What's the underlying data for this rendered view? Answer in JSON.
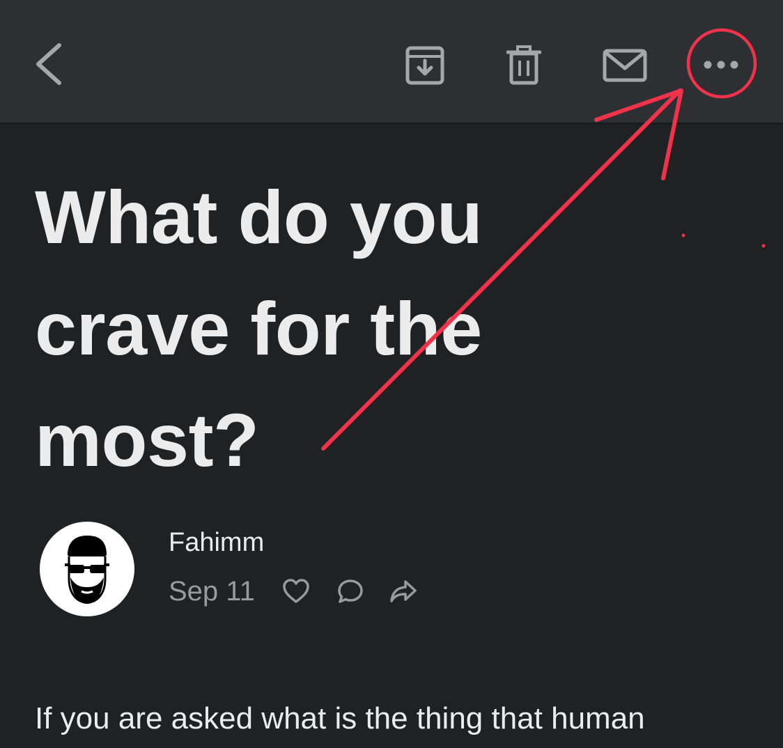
{
  "toolbar": {
    "back_icon": "chevron-left-icon",
    "archive_icon": "archive-icon",
    "trash_icon": "trash-icon",
    "mail_icon": "mail-icon",
    "more_icon": "more-horizontal-icon",
    "icon_color": "#a6a7ab"
  },
  "post": {
    "title": "What do you crave for the most?",
    "author": "Fahimm",
    "date": "Sep 11",
    "like_icon": "heart-icon",
    "comment_icon": "comment-icon",
    "share_icon": "share-icon",
    "body_start": "If you are asked what is the thing that human"
  },
  "annotation": {
    "color": "#f0324a",
    "shape": "circle-and-arrow",
    "target": "more-button"
  },
  "colors": {
    "background": "#202123",
    "toolbar": "#2e2f33",
    "text": "#ececec",
    "muted": "#9a9a9e"
  }
}
